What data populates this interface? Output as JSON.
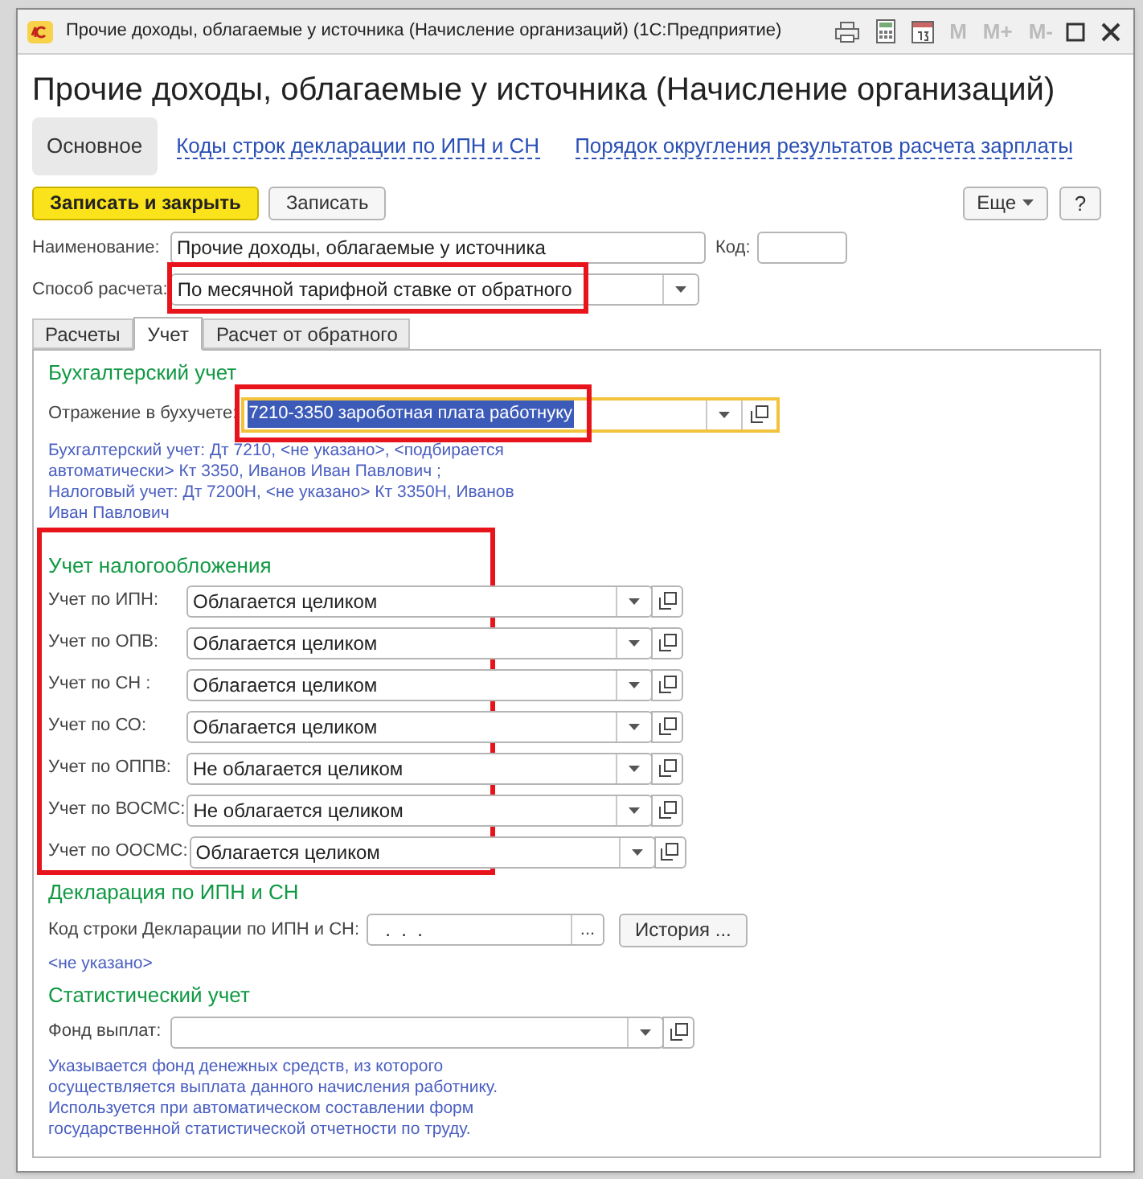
{
  "window": {
    "title": "Прочие доходы, облагаемые у источника (Начисление организаций)  (1С:Предприятие)",
    "toolbar": [
      "M",
      "M+",
      "M-"
    ]
  },
  "heading": "Прочие доходы, облагаемые у источника (Начисление организаций)",
  "nav": [
    {
      "label": "Основное",
      "selected": true
    },
    {
      "label": "Коды строк декларации по ИПН и СН",
      "selected": false
    },
    {
      "label": "Порядок округления результатов расчета зарплаты",
      "selected": false
    }
  ],
  "command_bar": {
    "buttons": [
      {
        "label": "Записать и закрыть",
        "kind": "primary"
      },
      {
        "label": "Записать",
        "kind": "normal"
      }
    ],
    "more": "Еще",
    "help": "?"
  },
  "name_field": {
    "label": "Наименование:",
    "value": "Прочие доходы, облагаемые у источника"
  },
  "code_field": {
    "label": "Код:"
  },
  "calc_method": {
    "label": "Способ расчета:",
    "value": "По месячной тарифной ставке от обратного",
    "highlighted": true
  },
  "tabs": [
    {
      "label": "Расчеты",
      "selected": false
    },
    {
      "label": "Учет",
      "selected": true
    },
    {
      "label": "Расчет от обратного",
      "selected": false
    }
  ],
  "accounting": {
    "title": "Бухгалтерский учет",
    "label": "Отражение в бухучете:",
    "value": "7210-3350 зароботная плата работнуку",
    "highlighted": true,
    "focused": true,
    "note": "Бухгалтерский учет: Дт 7210, <не указано>, <подбирается автоматически> Кт 3350, Иванов Иван Павлович ;\nНалоговый учет: Дт 7200Н, <не указано> Кт 3350Н, Иванов Иван Павлович"
  },
  "taxation": {
    "title": "Учет налогообложения",
    "highlighted": true,
    "rows": [
      {
        "label": "Учет по ИПН:",
        "value": "Облагается целиком"
      },
      {
        "label": "Учет по ОПВ:",
        "value": "Облагается целиком"
      },
      {
        "label": "Учет по СН :",
        "value": "Облагается целиком"
      },
      {
        "label": "Учет по СО:",
        "value": "Облагается целиком"
      },
      {
        "label": "Учет по ОППВ:",
        "value": "Не облагается целиком"
      },
      {
        "label": "Учет по ВОСМС:",
        "value": "Не облагается целиком"
      },
      {
        "label": "Учет по ООСМС:",
        "value": "Облагается целиком"
      }
    ]
  },
  "declaration": {
    "title": "Декларация по ИПН и СН",
    "label": "Код строки Декларации по ИПН и СН:",
    "value": "  .  .  .",
    "select": "...",
    "history": "История ...",
    "note": "<не указано>"
  },
  "statistics": {
    "title": "Статистический учет",
    "label": "Фонд выплат:",
    "note": "Указывается фонд денежных средств, из которого\nосуществляется выплата данного начисления работнику.\nИспользуется при автоматическом составлении форм\nгосударственной статистической отчетности по труду."
  }
}
